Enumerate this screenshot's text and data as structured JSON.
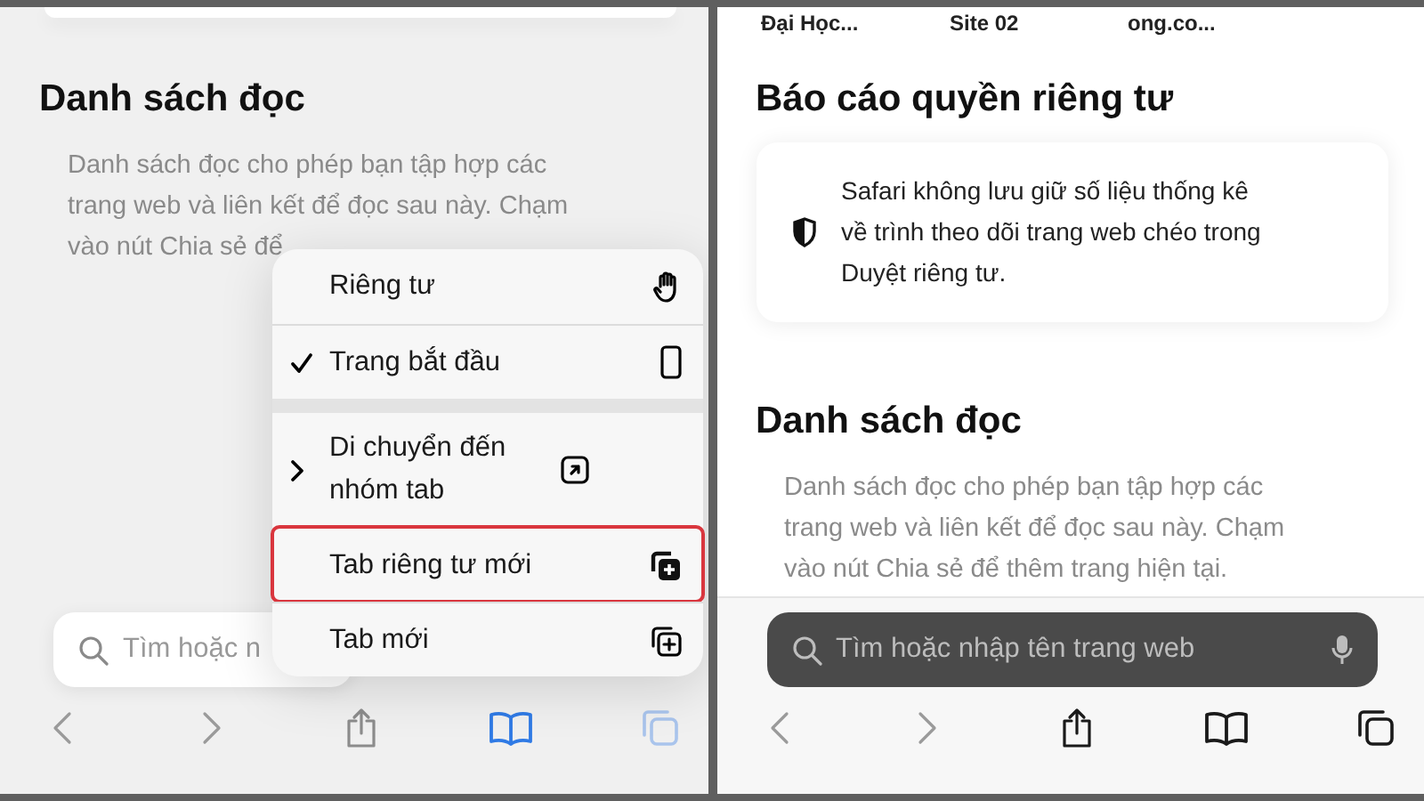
{
  "left_screen": {
    "menu_open": true,
    "reading_list": {
      "title": "Danh sách đọc",
      "lines": [
        "Danh sách đọc cho phép bạn tập hợp các",
        "trang web và liên kết để đọc sau này. Chạm",
        "vào nút Chia sẻ để"
      ]
    },
    "search": {
      "placeholder": "Tìm hoặc n"
    },
    "menu": {
      "groups": [
        [
          {
            "label": "Riêng tư",
            "kind": "action",
            "checked": false,
            "highlighted": false
          },
          {
            "label": "Trang bắt đầu",
            "kind": "action",
            "checked": true,
            "highlighted": false
          }
        ],
        [
          {
            "label": "Di chuyển đến nhóm tab",
            "kind": "submenu",
            "checked": false,
            "highlighted": false
          },
          {
            "label": "Tab riêng tư mới",
            "kind": "action",
            "checked": false,
            "highlighted": true
          },
          {
            "label": "Tab mới",
            "kind": "action",
            "checked": false,
            "highlighted": false
          }
        ]
      ]
    },
    "toolbar": [
      {
        "kind": "back",
        "disabled": true,
        "selected": false
      },
      {
        "kind": "forward",
        "disabled": true,
        "selected": false
      },
      {
        "kind": "share",
        "disabled": false,
        "selected": false
      },
      {
        "kind": "bookmarks",
        "disabled": false,
        "selected": true
      },
      {
        "kind": "tabs",
        "disabled": false,
        "selected": false
      }
    ]
  },
  "right_screen": {
    "menu_open": false,
    "favorites": [
      "Đại Học...",
      "Site 02",
      "ong.co..."
    ],
    "privacy_report": {
      "title": "Báo cáo quyền riêng tư",
      "text": "Safari không lưu giữ số liệu thống kê về trình theo dõi trang web chéo trong Duyệt riêng tư."
    },
    "reading_list": {
      "title": "Danh sách đọc",
      "lines": [
        "Danh sách đọc cho phép bạn tập hợp các",
        "trang web và liên kết để đọc sau này. Chạm",
        "vào nút Chia sẻ để thêm trang hiện tại."
      ]
    },
    "search": {
      "placeholder": "Tìm hoặc nhập tên trang web"
    },
    "toolbar": [
      {
        "kind": "back",
        "disabled": true,
        "selected": false
      },
      {
        "kind": "forward",
        "disabled": true,
        "selected": false
      },
      {
        "kind": "share",
        "disabled": false,
        "selected": false
      },
      {
        "kind": "bookmarks",
        "disabled": false,
        "selected": false
      },
      {
        "kind": "tabs",
        "disabled": false,
        "selected": false
      }
    ]
  }
}
